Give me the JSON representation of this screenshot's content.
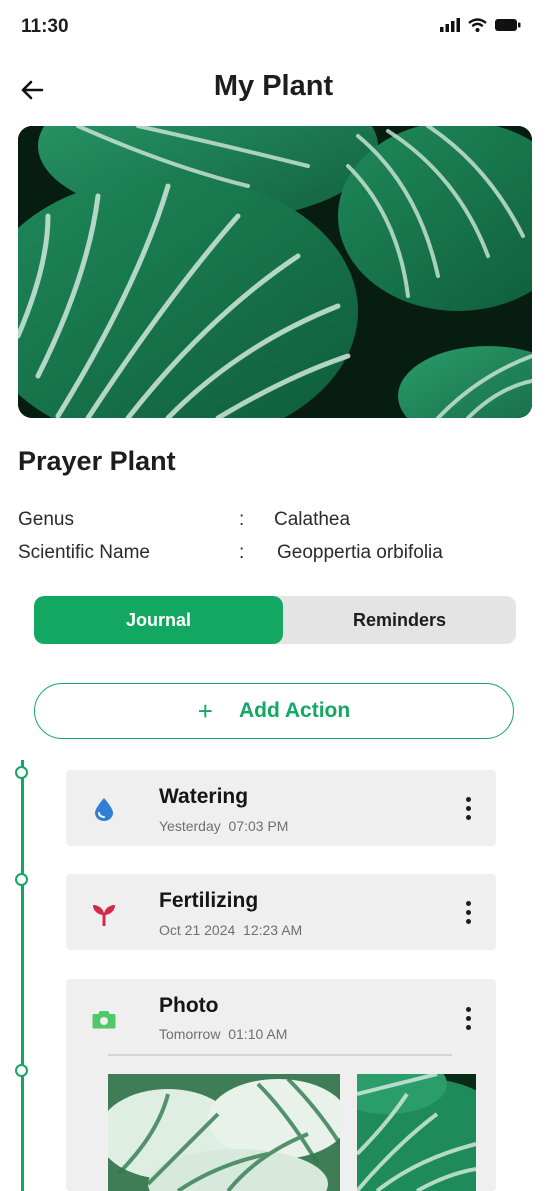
{
  "status": {
    "time": "11:30"
  },
  "header": {
    "title": "My Plant"
  },
  "plant": {
    "name": "Prayer Plant",
    "details": [
      {
        "label": "Genus",
        "value": "Calathea"
      },
      {
        "label": "Scientific Name",
        "value": "Geoppertia orbifolia"
      }
    ],
    "separator": ":"
  },
  "tabs": {
    "journal": "Journal",
    "reminders": "Reminders",
    "active": "journal"
  },
  "add_action": {
    "label": "Add Action",
    "icon": "+"
  },
  "journal": [
    {
      "title": "Watering",
      "subtitle": "Yesterday  07:03 PM",
      "icon": "water-drop-icon",
      "icon_color": "#2f7fd6"
    },
    {
      "title": "Fertilizing",
      "subtitle": "Oct 21 2024  12:23 AM",
      "icon": "sprout-icon",
      "icon_color": "#d12a4b"
    },
    {
      "title": "Photo",
      "subtitle": "Tomorrow  01:10 AM",
      "icon": "camera-icon",
      "icon_color": "#4fc86a"
    }
  ],
  "colors": {
    "accent": "#12a862",
    "card_bg": "#efefef",
    "tab_bg": "#e4e4e4"
  }
}
